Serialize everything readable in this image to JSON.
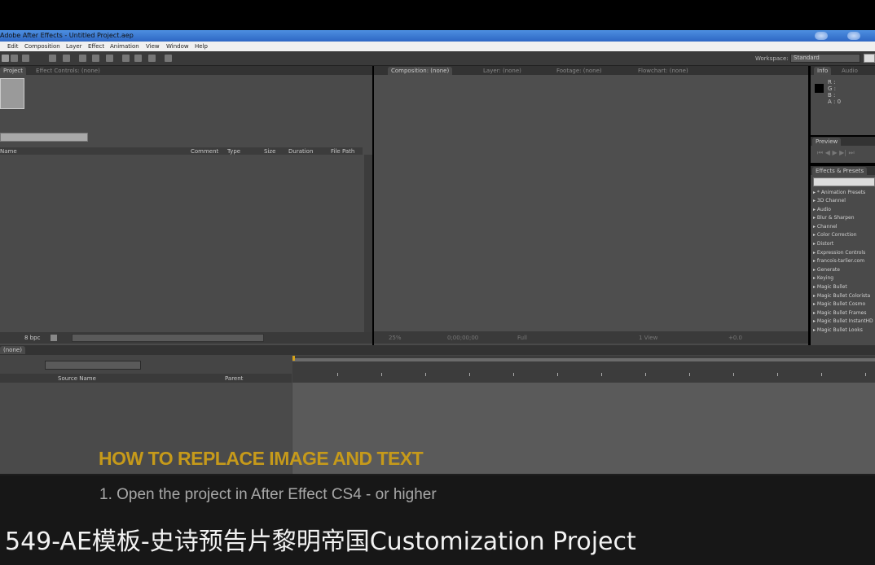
{
  "window": {
    "title": "Adobe After Effects - Untitled Project.aep"
  },
  "menu": [
    "Edit",
    "Composition",
    "Layer",
    "Effect",
    "Animation",
    "View",
    "Window",
    "Help"
  ],
  "workspace": {
    "label": "Workspace:",
    "value": "Standard"
  },
  "project_panel": {
    "tabs": [
      "Project",
      "Effect Controls: (none)"
    ],
    "columns": [
      "Name",
      "Comment",
      "Type",
      "Size",
      "Duration",
      "File Path"
    ],
    "bpc": "8 bpc"
  },
  "comp_panel": {
    "tabs": [
      "Composition: (none)",
      "Layer: (none)",
      "Footage: (none)",
      "Flowchart: (none)"
    ],
    "zoom": "25%",
    "timecode": "0;00;00;00",
    "resolution": "Full",
    "view": "1 View",
    "offset": "+0.0"
  },
  "info_panel": {
    "tabs": [
      "Info",
      "Audio"
    ],
    "readout": [
      "R :",
      "G :",
      "B :",
      "A : 0"
    ]
  },
  "preview_panel": {
    "title": "Preview"
  },
  "effects_panel": {
    "title": "Effects & Presets",
    "items": [
      "* Animation Presets",
      "3D Channel",
      "Audio",
      "Blur & Sharpen",
      "Channel",
      "Color Correction",
      "Distort",
      "Expression Controls",
      "francois-tarlier.com",
      "Generate",
      "Keying",
      "Magic Bullet",
      "Magic Bullet Colorista",
      "Magic Bullet Cosmo",
      "Magic Bullet Frames",
      "Magic Bullet InstantHD",
      "Magic Bullet Looks"
    ]
  },
  "timeline": {
    "tab": "(none)",
    "columns": [
      "Source Name",
      "Parent"
    ]
  },
  "overlay": {
    "heading": "HOW TO REPLACE IMAGE AND TEXT",
    "step": "1. Open the project in After Effect CS4 - or higher",
    "video_title": "549-AE模板-史诗预告片黎明帝国Customization Project"
  }
}
